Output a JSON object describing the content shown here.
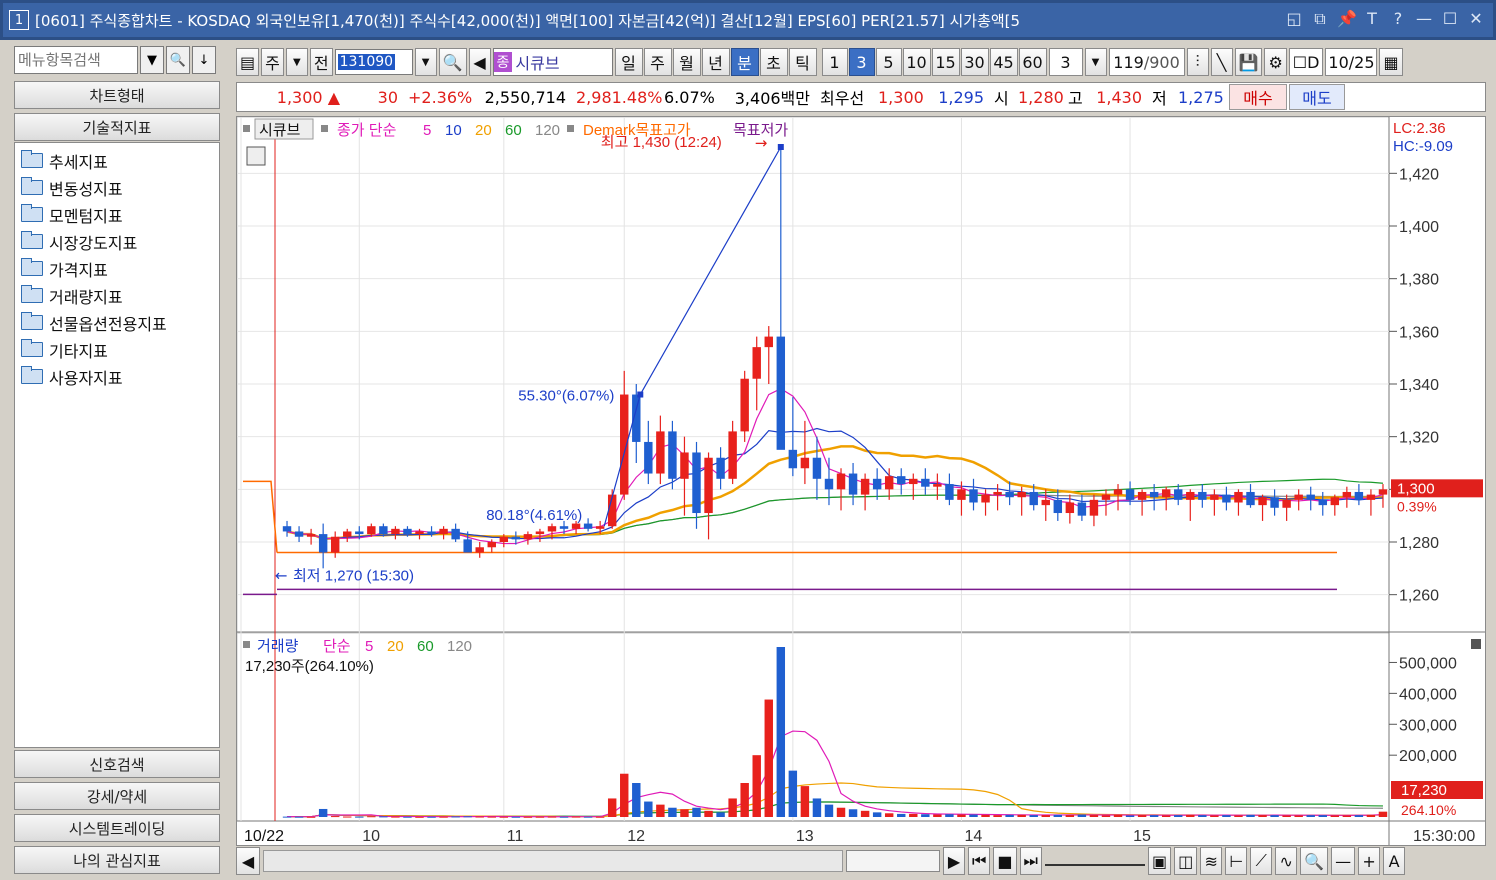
{
  "window": {
    "num": "1",
    "title": "[0601] 주식종합차트 - KOSDAQ 외국인보유[1,470(천)] 주식수[42,000(천)] 액면[100] 자본금[42(억)] 결산[12월] EPS[60] PER[21.57] 시가총액[5"
  },
  "left": {
    "search_placeholder": "메뉴항목검색",
    "chart_type": "차트형태",
    "tech_indicator": "기술적지표",
    "folders": [
      "추세지표",
      "변동성지표",
      "모멘텀지표",
      "시장강도지표",
      "가격지표",
      "거래량지표",
      "선물옵션전용지표",
      "기타지표",
      "사용자지표"
    ],
    "bottom": [
      "신호검색",
      "강세/약세",
      "시스템트레이딩",
      "나의 관심지표"
    ]
  },
  "toolbar": {
    "type1": "주",
    "type2": "전",
    "code": "131090",
    "name_tag": "종",
    "name": "시큐브",
    "periods": [
      "일",
      "주",
      "월",
      "년",
      "분",
      "초",
      "틱"
    ],
    "selected_period": "분",
    "intervals": [
      "1",
      "3",
      "5",
      "10",
      "15",
      "30",
      "45",
      "60"
    ],
    "selected_interval": "3",
    "interval_value": "3",
    "count": "119",
    "count_max": "/900",
    "date": "10/25"
  },
  "quote": {
    "price": "1,300",
    "change_arrow": "▲",
    "change": "30",
    "change_pct": "+2.36%",
    "volume": "2,550,714",
    "vol_pct": "2,981.48%",
    "turnover": "6.07%",
    "amount": "3,406백만",
    "best_label": "최우선",
    "best_bid": "1,300",
    "best_ask": "1,295",
    "open_label": "시",
    "open": "1,280",
    "high_label": "고",
    "high": "1,430",
    "low_label": "저",
    "low": "1,275",
    "buy": "매수",
    "sell": "매도"
  },
  "chart": {
    "legend_name": "시큐브",
    "legend_ma_label": "종가 단순",
    "ma_periods": [
      "5",
      "10",
      "20",
      "60",
      "120"
    ],
    "demark_high": "Demark목표고가",
    "demark_low": "목표저가",
    "max_label": "최고 1,430 (12:24)",
    "min_label": "최저 1,270 (15:30)",
    "angle1": "55.30°(6.07%)",
    "angle2": "80.18°(4.61%)",
    "lc": "LC:2.36",
    "hc": "HC:-9.09",
    "price_ticks": [
      "1,420",
      "1,400",
      "1,380",
      "1,360",
      "1,340",
      "1,320",
      "1,300",
      "1,280",
      "1,260"
    ],
    "current_price": "1,300",
    "current_pct": "0.39%",
    "vol_legend_name": "거래량",
    "vol_ma_label": "단순",
    "vol_ma_periods": [
      "5",
      "20",
      "60",
      "120"
    ],
    "vol_info": "17,230주(264.10%)",
    "vol_ticks": [
      "500,000",
      "400,000",
      "300,000",
      "200,000"
    ],
    "current_vol": "17,230",
    "current_vol_pct": "264.10%",
    "date_labels": [
      "10/22",
      "10",
      "11",
      "12",
      "13",
      "14",
      "15"
    ],
    "time_label": "15:30:00"
  },
  "chart_data": {
    "type": "candlestick",
    "y_range": [
      1250,
      1430
    ],
    "vol_range": [
      0,
      550000
    ],
    "colors": {
      "up": "#e8211c",
      "down": "#1f5fd0",
      "ma5": "#e01bb8",
      "ma10": "#1c3ec8",
      "ma20": "#f0a000",
      "ma60": "#1a9a2a",
      "ma120": "#888888",
      "demark_high": "#ff6a00",
      "demark_low": "#7a1a8c"
    },
    "candles": [
      [
        1286,
        1288,
        1282,
        1284,
        1200
      ],
      [
        1284,
        1286,
        1280,
        1282,
        900
      ],
      [
        1282,
        1285,
        1279,
        1283,
        700
      ],
      [
        1283,
        1287,
        1270,
        1276,
        26000
      ],
      [
        1276,
        1284,
        1274,
        1282,
        3000
      ],
      [
        1282,
        1285,
        1280,
        1284,
        1500
      ],
      [
        1284,
        1286,
        1281,
        1283,
        1200
      ],
      [
        1283,
        1287,
        1282,
        1286,
        2500
      ],
      [
        1286,
        1287,
        1282,
        1283,
        2000
      ],
      [
        1283,
        1286,
        1281,
        1285,
        1300
      ],
      [
        1285,
        1286,
        1282,
        1283,
        900
      ],
      [
        1283,
        1285,
        1281,
        1284,
        700
      ],
      [
        1284,
        1286,
        1282,
        1283,
        800
      ],
      [
        1283,
        1286,
        1281,
        1285,
        1000
      ],
      [
        1285,
        1287,
        1280,
        1281,
        1800
      ],
      [
        1281,
        1284,
        1278,
        1276,
        2200
      ],
      [
        1276,
        1280,
        1274,
        1278,
        1500
      ],
      [
        1278,
        1281,
        1276,
        1280,
        1200
      ],
      [
        1280,
        1283,
        1278,
        1282,
        900
      ],
      [
        1282,
        1284,
        1279,
        1281,
        800
      ],
      [
        1281,
        1284,
        1279,
        1283,
        700
      ],
      [
        1283,
        1285,
        1280,
        1284,
        900
      ],
      [
        1284,
        1287,
        1281,
        1286,
        1200
      ],
      [
        1286,
        1288,
        1283,
        1285,
        900
      ],
      [
        1285,
        1288,
        1283,
        1287,
        1300
      ],
      [
        1287,
        1289,
        1284,
        1285,
        1000
      ],
      [
        1285,
        1288,
        1283,
        1286,
        800
      ],
      [
        1286,
        1300,
        1285,
        1298,
        60000
      ],
      [
        1298,
        1345,
        1296,
        1336,
        140000
      ],
      [
        1336,
        1340,
        1310,
        1318,
        110000
      ],
      [
        1318,
        1326,
        1302,
        1306,
        50000
      ],
      [
        1306,
        1328,
        1302,
        1322,
        40000
      ],
      [
        1322,
        1326,
        1300,
        1304,
        30000
      ],
      [
        1304,
        1320,
        1290,
        1314,
        25000
      ],
      [
        1314,
        1318,
        1285,
        1291,
        30000
      ],
      [
        1291,
        1314,
        1281,
        1312,
        20000
      ],
      [
        1312,
        1316,
        1300,
        1304,
        15000
      ],
      [
        1304,
        1326,
        1302,
        1322,
        60000
      ],
      [
        1322,
        1345,
        1318,
        1342,
        110000
      ],
      [
        1342,
        1358,
        1330,
        1354,
        200000
      ],
      [
        1354,
        1362,
        1340,
        1358,
        380000
      ],
      [
        1358,
        1430,
        1336,
        1315,
        550000
      ],
      [
        1315,
        1335,
        1305,
        1308,
        150000
      ],
      [
        1308,
        1326,
        1302,
        1312,
        100000
      ],
      [
        1312,
        1320,
        1296,
        1304,
        60000
      ],
      [
        1304,
        1312,
        1294,
        1300,
        40000
      ],
      [
        1300,
        1308,
        1292,
        1306,
        30000
      ],
      [
        1306,
        1310,
        1294,
        1298,
        25000
      ],
      [
        1298,
        1306,
        1292,
        1304,
        20000
      ],
      [
        1304,
        1308,
        1296,
        1300,
        15000
      ],
      [
        1300,
        1308,
        1296,
        1305,
        12000
      ],
      [
        1305,
        1308,
        1298,
        1302,
        10000
      ],
      [
        1302,
        1306,
        1296,
        1304,
        10000
      ],
      [
        1304,
        1308,
        1298,
        1301,
        9000
      ],
      [
        1301,
        1306,
        1296,
        1302,
        8000
      ],
      [
        1302,
        1306,
        1294,
        1296,
        9000
      ],
      [
        1296,
        1303,
        1290,
        1300,
        8000
      ],
      [
        1300,
        1304,
        1292,
        1295,
        8000
      ],
      [
        1295,
        1300,
        1290,
        1298,
        7000
      ],
      [
        1298,
        1302,
        1292,
        1299,
        6000
      ],
      [
        1299,
        1303,
        1294,
        1297,
        7000
      ],
      [
        1297,
        1301,
        1290,
        1299,
        7000
      ],
      [
        1299,
        1302,
        1292,
        1294,
        6000
      ],
      [
        1294,
        1300,
        1288,
        1296,
        6000
      ],
      [
        1296,
        1300,
        1288,
        1291,
        7000
      ],
      [
        1291,
        1298,
        1287,
        1295,
        6000
      ],
      [
        1295,
        1298,
        1288,
        1290,
        8000
      ],
      [
        1290,
        1298,
        1286,
        1296,
        6000
      ],
      [
        1296,
        1300,
        1290,
        1298,
        5000
      ],
      [
        1298,
        1302,
        1292,
        1300,
        7000
      ],
      [
        1300,
        1303,
        1294,
        1296,
        5000
      ],
      [
        1296,
        1300,
        1290,
        1299,
        6000
      ],
      [
        1299,
        1302,
        1292,
        1297,
        6000
      ],
      [
        1297,
        1301,
        1292,
        1300,
        5000
      ],
      [
        1300,
        1302,
        1294,
        1296,
        6000
      ],
      [
        1296,
        1300,
        1288,
        1299,
        7000
      ],
      [
        1299,
        1302,
        1293,
        1296,
        6000
      ],
      [
        1296,
        1300,
        1290,
        1298,
        5000
      ],
      [
        1298,
        1301,
        1292,
        1295,
        6000
      ],
      [
        1295,
        1300,
        1290,
        1299,
        5000
      ],
      [
        1299,
        1302,
        1293,
        1294,
        7000
      ],
      [
        1294,
        1298,
        1288,
        1297,
        6000
      ],
      [
        1297,
        1300,
        1290,
        1293,
        6000
      ],
      [
        1293,
        1298,
        1288,
        1296,
        5000
      ],
      [
        1296,
        1300,
        1292,
        1298,
        5000
      ],
      [
        1298,
        1301,
        1292,
        1296,
        6000
      ],
      [
        1296,
        1299,
        1290,
        1294,
        6000
      ],
      [
        1294,
        1298,
        1290,
        1297,
        5000
      ],
      [
        1297,
        1301,
        1293,
        1299,
        5000
      ],
      [
        1299,
        1302,
        1294,
        1296,
        6000
      ],
      [
        1296,
        1300,
        1290,
        1298,
        7000
      ],
      [
        1298,
        1302,
        1293,
        1300,
        17230
      ]
    ]
  }
}
